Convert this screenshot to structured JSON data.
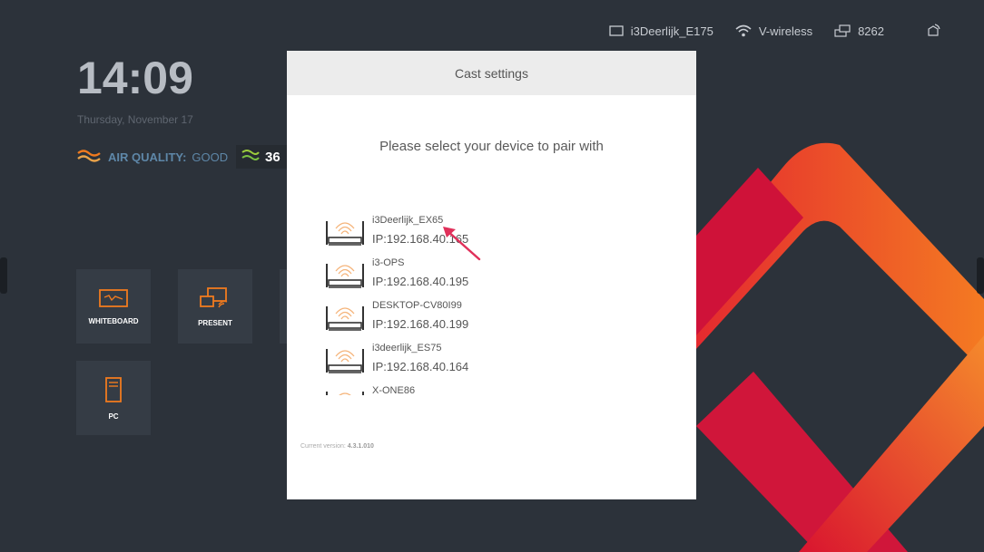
{
  "status_bar": {
    "display_name": "i3Deerlijk_E175",
    "wifi_name": "V-wireless",
    "pair_code": "8262",
    "icons": [
      "screen-icon",
      "wifi-icon",
      "network-icon",
      "cast-icon"
    ]
  },
  "clock": {
    "time": "14:09",
    "date": "Thursday, November 17"
  },
  "air_quality": {
    "label": "AIR QUALITY:",
    "value": "GOOD",
    "reading": "36"
  },
  "tiles": [
    {
      "label": "WHITEBOARD",
      "icon": "whiteboard-icon"
    },
    {
      "label": "PRESENT",
      "icon": "present-icon"
    },
    {
      "label": "PC",
      "icon": "pc-icon"
    }
  ],
  "dialog": {
    "title": "Cast settings",
    "prompt": "Please select your device to pair with",
    "devices": [
      {
        "name": "i3Deerlijk_EX65",
        "ip": "IP:192.168.40.165"
      },
      {
        "name": "i3-OPS",
        "ip": "IP:192.168.40.195"
      },
      {
        "name": "DESKTOP-CV80I99",
        "ip": "IP:192.168.40.199"
      },
      {
        "name": "i3deerlijk_ES75",
        "ip": "IP:192.168.40.164"
      },
      {
        "name": "X-ONE86",
        "ip": ""
      }
    ],
    "version_label": "Current version:",
    "version_number": "4.3.1.010"
  },
  "colors": {
    "background": "#2c323a",
    "accent_orange": "#f07a1e",
    "accent_red": "#d2173c",
    "air_label": "#5e87a8",
    "arrow": "#e0305a"
  }
}
